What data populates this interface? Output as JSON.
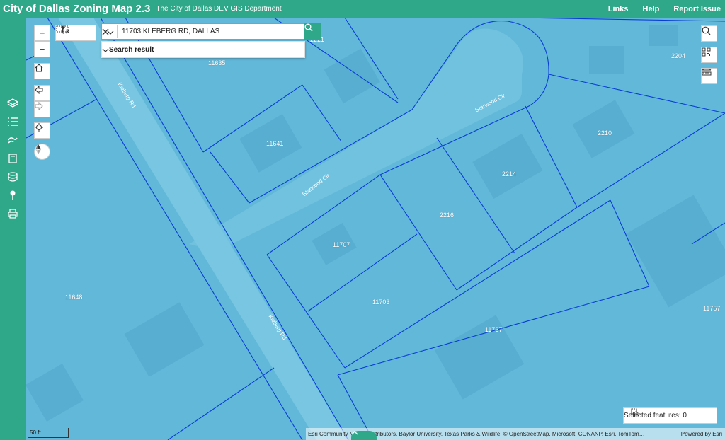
{
  "header": {
    "title": "City of Dallas Zoning Map 2.3",
    "subtitle": "The City of Dallas DEV GIS Department",
    "links": [
      "Links",
      "Help",
      "Report Issue"
    ]
  },
  "sidebar": {
    "icons": [
      "layers-icon",
      "legend-list-icon",
      "basemap-icon",
      "bookmark-icon",
      "database-icon",
      "info-pin-icon",
      "print-icon"
    ]
  },
  "toolbar": {
    "zoom_in": "+",
    "zoom_out": "−"
  },
  "search": {
    "value": "11703 KLEBERG RD, DALLAS",
    "suggestion": "Search result"
  },
  "map": {
    "parcel_labels": [
      "2221",
      "11635",
      "2204",
      "2210",
      "11641",
      "2214",
      "2216",
      "11707",
      "11648",
      "11703",
      "11737",
      "11757"
    ],
    "street_labels": [
      "Kleberg Rd",
      "Starwood Cir",
      "Starwood Cir",
      "Kleberg Rd"
    ],
    "fill_color": "#62b8d9",
    "line_color": "#0a3dd6"
  },
  "selected": {
    "label": "Selected features: 0"
  },
  "scalebar": {
    "label": "50 ft"
  },
  "attribution": {
    "text": "Esri Community Maps Contributors, Baylor University, Texas Parks & Wildlife, © OpenStreetMap, Microsoft, CONANP, Esri, TomTom…",
    "powered": "Powered by Esri"
  }
}
